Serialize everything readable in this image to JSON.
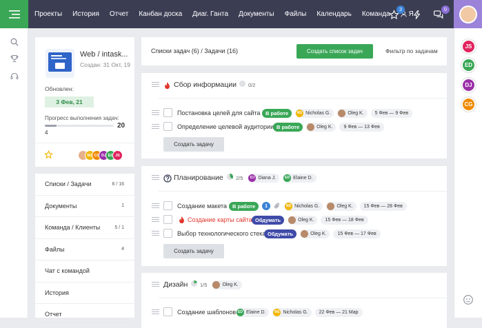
{
  "nav": {
    "items": [
      "Проекты",
      "История",
      "Отчет",
      "Канбан доска",
      "Диаг. Ганта",
      "Документы",
      "Файлы",
      "Календарь",
      "Команда"
    ],
    "user_label": "Я",
    "badges": {
      "favorites": "3",
      "messages": "0"
    }
  },
  "icons": {
    "menu": "menu-icon",
    "search": "search-icon",
    "trophy": "trophy-icon",
    "headset": "headset-icon",
    "star": "star-icon",
    "lightning": "lightning-icon",
    "chat": "chat-icon",
    "support": "support-icon",
    "user": "user-icon"
  },
  "colors": {
    "green": "#3aa757",
    "navy": "#3b3e53",
    "blue_tag": "#3f4ba8",
    "red": "#e0362c",
    "purple": "#9b2fa8",
    "orange": "#f08a00"
  },
  "project": {
    "title": "Web / intask...",
    "created": "Создан: 31 Окт, 19",
    "updated_label": "Обновлен:",
    "updated_value": "3 Фев, 21",
    "progress_label": "Прогресс выполнения задач:",
    "progress_done": "20",
    "progress_total": "4",
    "progress_fraction": 0.17,
    "team": [
      {
        "initials": "",
        "color": "#e6b08a"
      },
      {
        "initials": "NG",
        "color": "#f2b705"
      },
      {
        "initials": "CG",
        "color": "#f08a00"
      },
      {
        "initials": "DJ",
        "color": "#9b2fa8"
      },
      {
        "initials": "ED",
        "color": "#3aa757"
      },
      {
        "initials": "JS",
        "color": "#e0245e"
      }
    ]
  },
  "menu": [
    {
      "label": "Списки / Задачи",
      "count": "6 / 16"
    },
    {
      "label": "Документы",
      "count": "1"
    },
    {
      "label": "Команда / Клиенты",
      "count": "5 / 1"
    },
    {
      "label": "Файлы",
      "count": "4"
    },
    {
      "label": "Чат с командой",
      "count": ""
    },
    {
      "label": "История",
      "count": ""
    },
    {
      "label": "Отчет",
      "count": ""
    }
  ],
  "header": {
    "summary": "Списки задач (6) / Задачи (16)",
    "create_button": "Создать список задач",
    "filter_link": "Фильтр по задачам"
  },
  "groups": [
    {
      "title": "Сбор информации",
      "progress": "0/2",
      "members": [],
      "tasks": [
        {
          "title": "Постановка целей для сайта",
          "status": "В работе",
          "status_color": "#3aa757",
          "people": [
            {
              "name": "Nicholas G.",
              "initials": "NG",
              "color": "#f2b705"
            },
            {
              "name": "Oleg K.",
              "initials": "",
              "color": "#b88a6a"
            }
          ],
          "dates": "5 Фев — 9 Фев"
        },
        {
          "title": "Определение целевой аудитории",
          "status": "В работе",
          "status_color": "#3aa757",
          "people": [
            {
              "name": "Oleg K.",
              "initials": "",
              "color": "#b88a6a"
            }
          ],
          "dates": "9 Фев — 13 Фев"
        }
      ],
      "add_button": "Создать задачу"
    },
    {
      "title": "Планирование",
      "progress": "2/5",
      "members": [
        {
          "name": "Diana J.",
          "initials": "DJ",
          "color": "#9b2fa8"
        },
        {
          "name": "Elaine D.",
          "initials": "ED",
          "color": "#3aa757"
        }
      ],
      "tasks": [
        {
          "title": "Создание макета",
          "status": "В работе",
          "status_color": "#3aa757",
          "comments": "1",
          "people": [
            {
              "name": "Nicholas G.",
              "initials": "NG",
              "color": "#f2b705"
            },
            {
              "name": "Oleg K.",
              "initials": "",
              "color": "#b88a6a"
            }
          ],
          "dates": "15 Фев — 28 Фев"
        },
        {
          "title": "Создание карты сайта",
          "status": "Обдумать",
          "status_color": "#3f4ba8",
          "people": [
            {
              "name": "Oleg K.",
              "initials": "",
              "color": "#b88a6a"
            }
          ],
          "dates": "15 Фев — 18 Фев"
        },
        {
          "title": "Выбор технологического стека",
          "status": "Обдумать",
          "status_color": "#3f4ba8",
          "people": [
            {
              "name": "Oleg K.",
              "initials": "",
              "color": "#b88a6a"
            }
          ],
          "dates": "15 Фев — 17 Фев"
        }
      ],
      "add_button": "Создать задачу"
    },
    {
      "title": "Дизайн",
      "progress": "1/5",
      "members": [
        {
          "name": "Oleg K.",
          "initials": "",
          "color": "#b88a6a"
        }
      ],
      "tasks": [
        {
          "title": "Создание шаблонов",
          "people": [
            {
              "name": "Elaine D.",
              "initials": "ED",
              "color": "#3aa757"
            },
            {
              "name": "Nicholas G.",
              "initials": "NG",
              "color": "#f2b705"
            }
          ],
          "dates": "22 Фев — 21 Мар"
        }
      ]
    }
  ],
  "right_rail": [
    {
      "initials": "JS",
      "color": "#e0245e"
    },
    {
      "initials": "ED",
      "color": "#3aa757"
    },
    {
      "initials": "DJ",
      "color": "#9b2fa8"
    },
    {
      "initials": "CG",
      "color": "#f08a00"
    }
  ]
}
